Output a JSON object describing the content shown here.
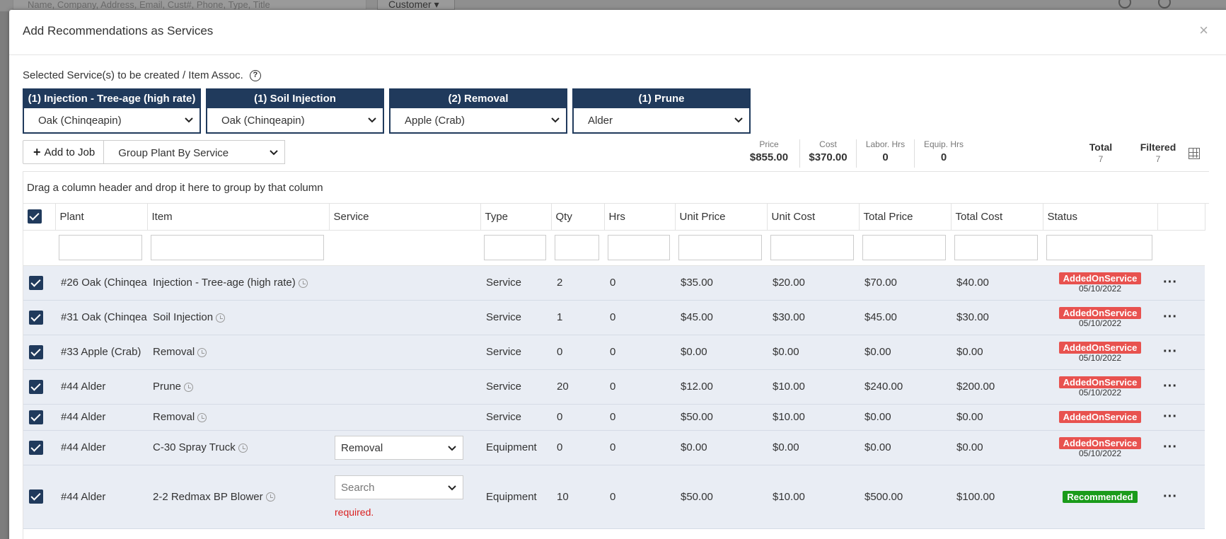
{
  "background": {
    "search_placeholder": "Name, Company, Address, Email, Cust#, Phone, Type, Title",
    "search_type": "Customer"
  },
  "modal": {
    "title": "Add Recommendations as Services",
    "close_label": "×"
  },
  "selection": {
    "label": "Selected Service(s) to be created / Item Assoc.",
    "services": [
      {
        "name": "(1) Injection - Tree-age (high rate)",
        "plant": "Oak (Chinqeapin)"
      },
      {
        "name": "(1) Soil Injection",
        "plant": "Oak (Chinqeapin)"
      },
      {
        "name": "(2) Removal",
        "plant": "Apple (Crab)"
      },
      {
        "name": "(1) Prune",
        "plant": "Alder"
      }
    ]
  },
  "toolbar": {
    "add_label": "Add to Job",
    "group_select": "Group Plant By Service"
  },
  "stats": {
    "price_label": "Price",
    "price": "$855.00",
    "cost_label": "Cost",
    "cost": "$370.00",
    "labor_label": "Labor. Hrs",
    "labor": "0",
    "equip_label": "Equip. Hrs",
    "equip": "0",
    "total_label": "Total",
    "total": "7",
    "filtered_label": "Filtered",
    "filtered": "7"
  },
  "grid": {
    "group_hint": "Drag a column header and drop it here to group by that column",
    "columns": [
      "Plant",
      "Item",
      "Service",
      "Type",
      "Qty",
      "Hrs",
      "Unit Price",
      "Unit Cost",
      "Total Price",
      "Total Cost",
      "Status"
    ],
    "rows": [
      {
        "plant": "#26 Oak (Chinqea",
        "item": "Injection - Tree-age (high rate)",
        "service": "",
        "type": "Service",
        "qty": "2",
        "hrs": "0",
        "unit_price": "$35.00",
        "unit_cost": "$20.00",
        "total_price": "$70.00",
        "total_cost": "$40.00",
        "status": "AddedOnService",
        "date": "05/10/2022"
      },
      {
        "plant": "#31 Oak (Chinqea",
        "item": "Soil Injection",
        "service": "",
        "type": "Service",
        "qty": "1",
        "hrs": "0",
        "unit_price": "$45.00",
        "unit_cost": "$30.00",
        "total_price": "$45.00",
        "total_cost": "$30.00",
        "status": "AddedOnService",
        "date": "05/10/2022"
      },
      {
        "plant": "#33 Apple (Crab)",
        "item": "Removal",
        "service": "",
        "type": "Service",
        "qty": "0",
        "hrs": "0",
        "unit_price": "$0.00",
        "unit_cost": "$0.00",
        "total_price": "$0.00",
        "total_cost": "$0.00",
        "status": "AddedOnService",
        "date": "05/10/2022"
      },
      {
        "plant": "#44 Alder",
        "item": "Prune",
        "service": "",
        "type": "Service",
        "qty": "20",
        "hrs": "0",
        "unit_price": "$12.00",
        "unit_cost": "$10.00",
        "total_price": "$240.00",
        "total_cost": "$200.00",
        "status": "AddedOnService",
        "date": "05/10/2022"
      },
      {
        "plant": "#44 Alder",
        "item": "Removal",
        "service": "",
        "type": "Service",
        "qty": "0",
        "hrs": "0",
        "unit_price": "$50.00",
        "unit_cost": "$10.00",
        "total_price": "$0.00",
        "total_cost": "$0.00",
        "status": "AddedOnService",
        "date": ""
      },
      {
        "plant": "#44 Alder",
        "item": "C-30 Spray Truck",
        "service": "Removal",
        "type": "Equipment",
        "qty": "0",
        "hrs": "0",
        "unit_price": "$0.00",
        "unit_cost": "$0.00",
        "total_price": "$0.00",
        "total_cost": "$0.00",
        "status": "AddedOnService",
        "date": "05/10/2022"
      },
      {
        "plant": "#44 Alder",
        "item": "2-2 Redmax BP Blower",
        "service": "Search",
        "type": "Equipment",
        "qty": "10",
        "hrs": "0",
        "unit_price": "$50.00",
        "unit_cost": "$10.00",
        "total_price": "$500.00",
        "total_cost": "$100.00",
        "status": "Recommended",
        "date": "",
        "note": "required."
      }
    ]
  },
  "colors": {
    "navy": "#203a5c",
    "badge_red": "#e8524f",
    "badge_green": "#1a9b1a",
    "row_bg": "#e9edf4"
  }
}
